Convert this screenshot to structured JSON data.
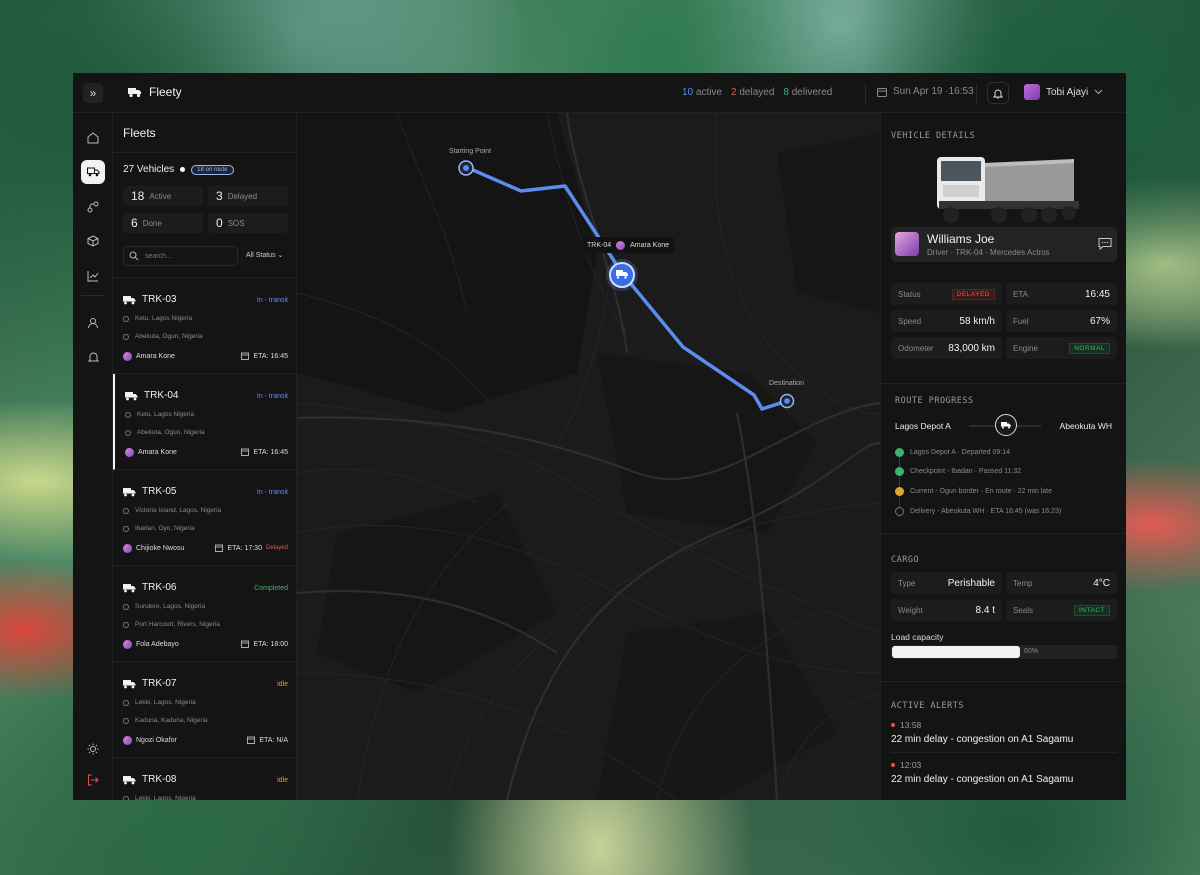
{
  "app": {
    "name": "Fleety"
  },
  "header": {
    "stats": {
      "active_count": "10",
      "active_label": "active",
      "delayed_count": "2",
      "delayed_label": "delayed",
      "delivered_count": "8",
      "delivered_label": "delivered"
    },
    "datetime": "Sun Apr 19 ·16:53",
    "user_name": "Tobi Ajayi"
  },
  "fleets": {
    "title": "Fleets",
    "vehicle_count": "27 Vehicles",
    "on_route_badge": "18 on route",
    "stats": [
      {
        "value": "18",
        "label": "Active"
      },
      {
        "value": "3",
        "label": "Delayed"
      },
      {
        "value": "6",
        "label": "Done"
      },
      {
        "value": "0",
        "label": "SOS"
      }
    ],
    "search_placeholder": "search...",
    "filter_label": "All Status",
    "vehicles": [
      {
        "id": "TRK-03",
        "status": "In - transit",
        "from": "Ketu, Lagos Nigeria",
        "to": "Abekuta, Ogun, Nigeria",
        "driver": "Amara Kone",
        "eta": "ETA: 16:45",
        "delayed": ""
      },
      {
        "id": "TRK-04",
        "status": "In - transit",
        "from": "Ketu, Lagos Nigeria",
        "to": "Abekuta, Ogun, Nigeria",
        "driver": "Amara Kone",
        "eta": "ETA: 16:45",
        "delayed": ""
      },
      {
        "id": "TRK-05",
        "status": "In - transit",
        "from": "Victoria Island, Lagos, Nigeria",
        "to": "Ibadan, Oyo, Nigeria",
        "driver": "Chijioke Nwosu",
        "eta": "ETA: 17:30",
        "delayed": "Delayed"
      },
      {
        "id": "TRK-06",
        "status": "Completed",
        "from": "Surulere, Lagos, Nigeria",
        "to": "Port Harcourt, Rivers, Nigeria",
        "driver": "Fola Adebayo",
        "eta": "ETA: 18:00",
        "delayed": ""
      },
      {
        "id": "TRK-07",
        "status": "idle",
        "from": "Lekki, Lagos, Nigeria",
        "to": "Kaduna, Kaduna, Nigeria",
        "driver": "Ngozi Okafor",
        "eta": "ETA: N/A",
        "delayed": ""
      },
      {
        "id": "TRK-08",
        "status": "idle",
        "from": "Lekki, Lagos, Nigeria",
        "to": "",
        "driver": "",
        "eta": "",
        "delayed": ""
      }
    ]
  },
  "map": {
    "start_label": "Starting Point",
    "end_label": "Destination",
    "vehicle_tag": "TRK-04",
    "vehicle_driver": "Amara Kone"
  },
  "details": {
    "vehicle_title": "VEHICLE DETAILS",
    "driver_name": "Williams Joe",
    "driver_sub": "Driver · TRK-04 · Mercedes Actros",
    "status_label": "Status",
    "status_value": "DELAYED",
    "eta_label": "ETA",
    "eta_value": "16:45",
    "speed_label": "Speed",
    "speed_value": "58 km/h",
    "fuel_label": "Fuel",
    "fuel_value": "67%",
    "odometer_label": "Odometer",
    "odometer_value": "83,000 km",
    "engine_label": "Engine",
    "engine_value": "NORMAL",
    "route_title": "ROUTE PROGRESS",
    "route_from": "Lagos Depot A",
    "route_to": "Abeokuta WH",
    "timeline": [
      "Lagos Depot A · Departed 09:14",
      "Checkpoint - Ibadan · Passed 11:32",
      "Current - Ogun border · En route · 22 min late",
      "Delivery - Abeokuta WH · ETA 16:45 (was 16:23)"
    ],
    "cargo_title": "CARGO",
    "type_label": "Type",
    "type_value": "Perishable",
    "temp_label": "Temp",
    "temp_value": "4°C",
    "weight_label": "Weight",
    "weight_value": "8.4 t",
    "seals_label": "Seals",
    "seals_value": "INTACT",
    "load_label": "Load capacity",
    "load_percent": "60%",
    "load_fraction": 0.6,
    "alerts_title": "ACTIVE ALERTS",
    "alerts": [
      {
        "time": "13:58",
        "message": "22 min delay - congestion on A1 Sagamu"
      },
      {
        "time": "12:03",
        "message": "22 min delay - congestion on A1 Sagamu"
      }
    ]
  },
  "colors": {
    "accent_blue": "#5b8df0",
    "delayed_red": "#e0574f",
    "delivered_green": "#3fb36b",
    "idle_orange": "#e0a23a"
  }
}
